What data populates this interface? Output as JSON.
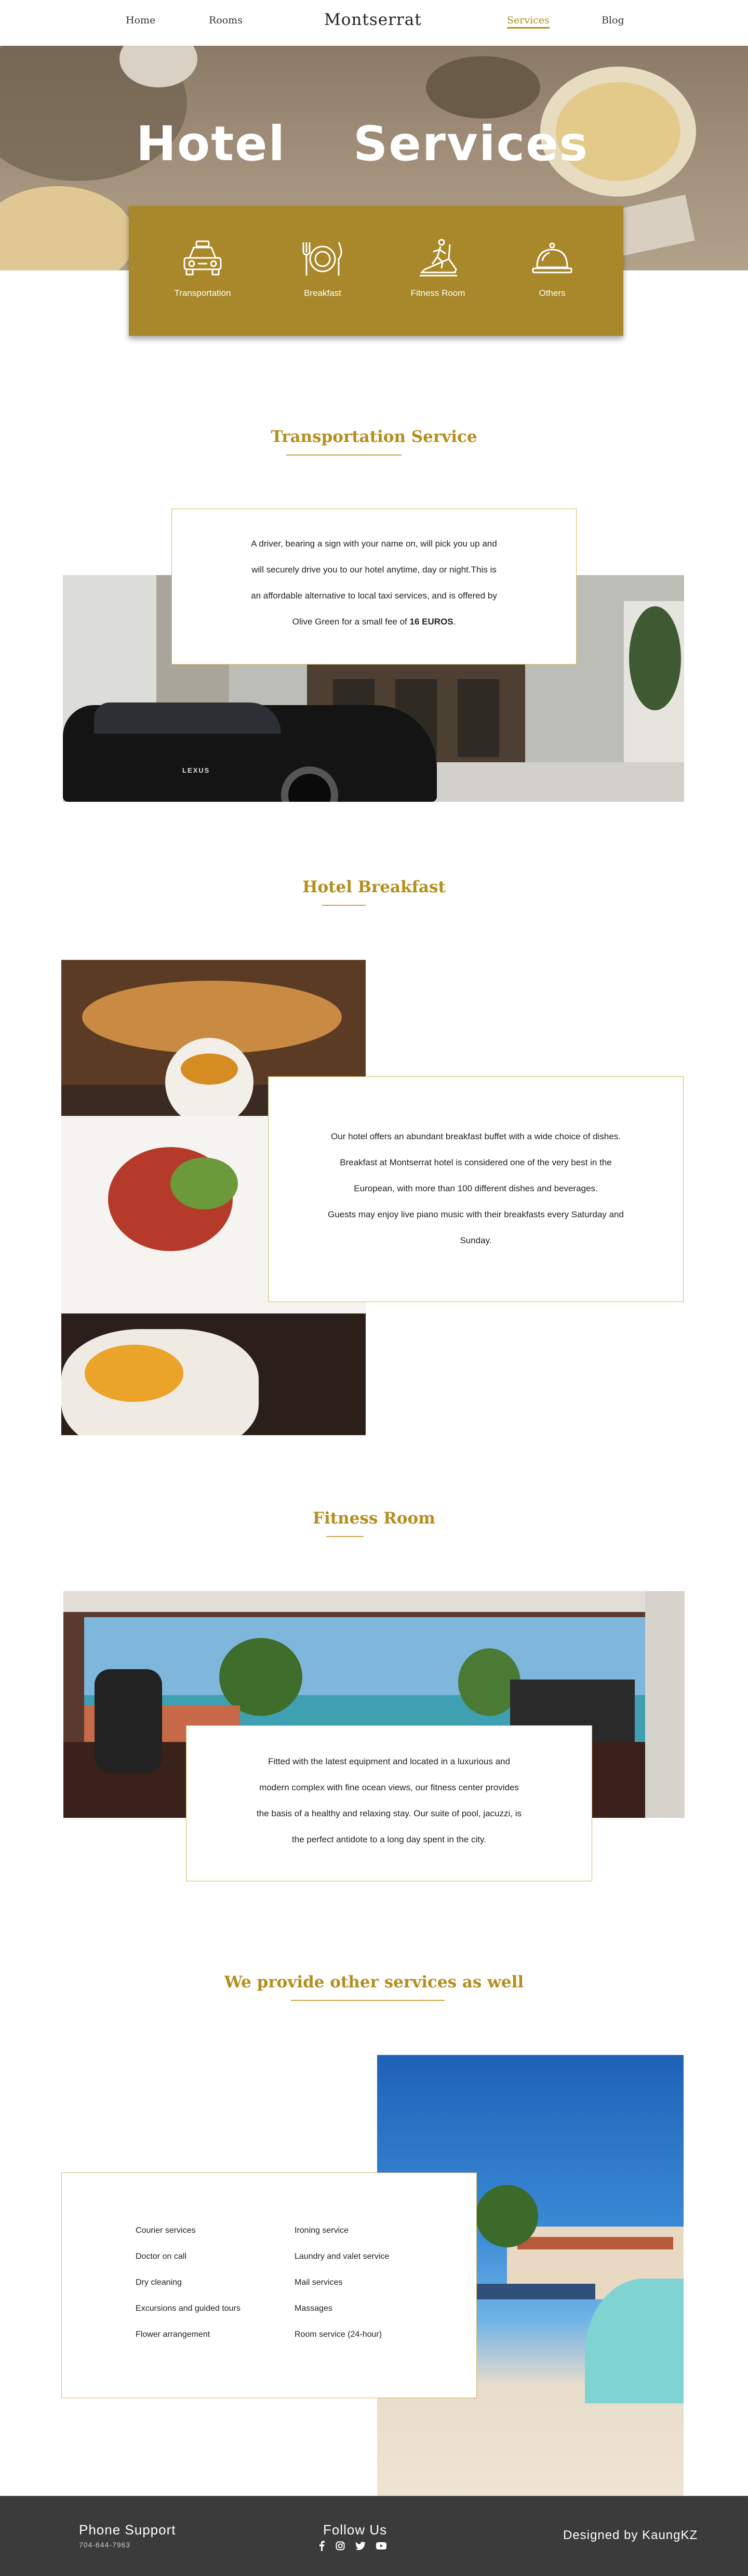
{
  "nav": {
    "home": "Home",
    "rooms": "Rooms",
    "brand": "Montserrat",
    "services": "Services",
    "blog": "Blog"
  },
  "hero": {
    "word1": "Hotel",
    "word2": "Services"
  },
  "services_bar": [
    {
      "label": "Transportation",
      "icon": "taxi-icon"
    },
    {
      "label": "Breakfast",
      "icon": "plate-cutlery-icon"
    },
    {
      "label": "Fitness Room",
      "icon": "treadmill-icon"
    },
    {
      "label": "Others",
      "icon": "service-bell-icon"
    }
  ],
  "transport": {
    "title": "Transportation Service",
    "line1": "A driver, bearing a sign with your name on, will pick you up and",
    "line2": "will securely drive you to our hotel anytime, day or night.This is",
    "line3": "an affordable alternative to local taxi services, and is offered by",
    "line4": "Olive Green for a small fee of ",
    "price": "16 EUROS",
    "period": ".",
    "car_badge": "LEXUS"
  },
  "breakfast": {
    "title": "Hotel Breakfast",
    "line1": "Our hotel offers an abundant breakfast buffet with a wide choice of dishes.",
    "line2": "Breakfast at Montserrat hotel is considered one of the very best in the",
    "line3": "European, with more than 100 different dishes and beverages.",
    "line4": "Guests may enjoy live piano music with their breakfasts every Saturday and",
    "line5": "Sunday."
  },
  "fitness": {
    "title": "Fitness Room",
    "line1": "Fitted with the latest equipment and located in a luxurious and",
    "line2": "modern complex with fine ocean views, our fitness center provides",
    "line3": "the basis of a healthy and relaxing stay. Our suite of pool, jacuzzi, is",
    "line4": "the perfect antidote to a long day spent in the city."
  },
  "others": {
    "title": "We provide other services as well",
    "col1": [
      "Courier services",
      "Doctor on call",
      "Dry cleaning",
      "Excursions and guided tours",
      "Flower arrangement"
    ],
    "col2": [
      "Ironing service",
      "Laundry and valet service",
      "Mail services",
      "Massages",
      "Room service (24-hour)"
    ]
  },
  "footer": {
    "phone_label": "Phone Support",
    "phone": "704-644-7963",
    "follow": "Follow Us",
    "social": [
      "facebook-icon",
      "instagram-icon",
      "twitter-icon",
      "youtube-icon"
    ],
    "credit": "Designed by KaungKZ"
  },
  "colors": {
    "gold": "#a8882a",
    "title_gold": "#b58e1e",
    "footer": "#3b3b3b"
  }
}
